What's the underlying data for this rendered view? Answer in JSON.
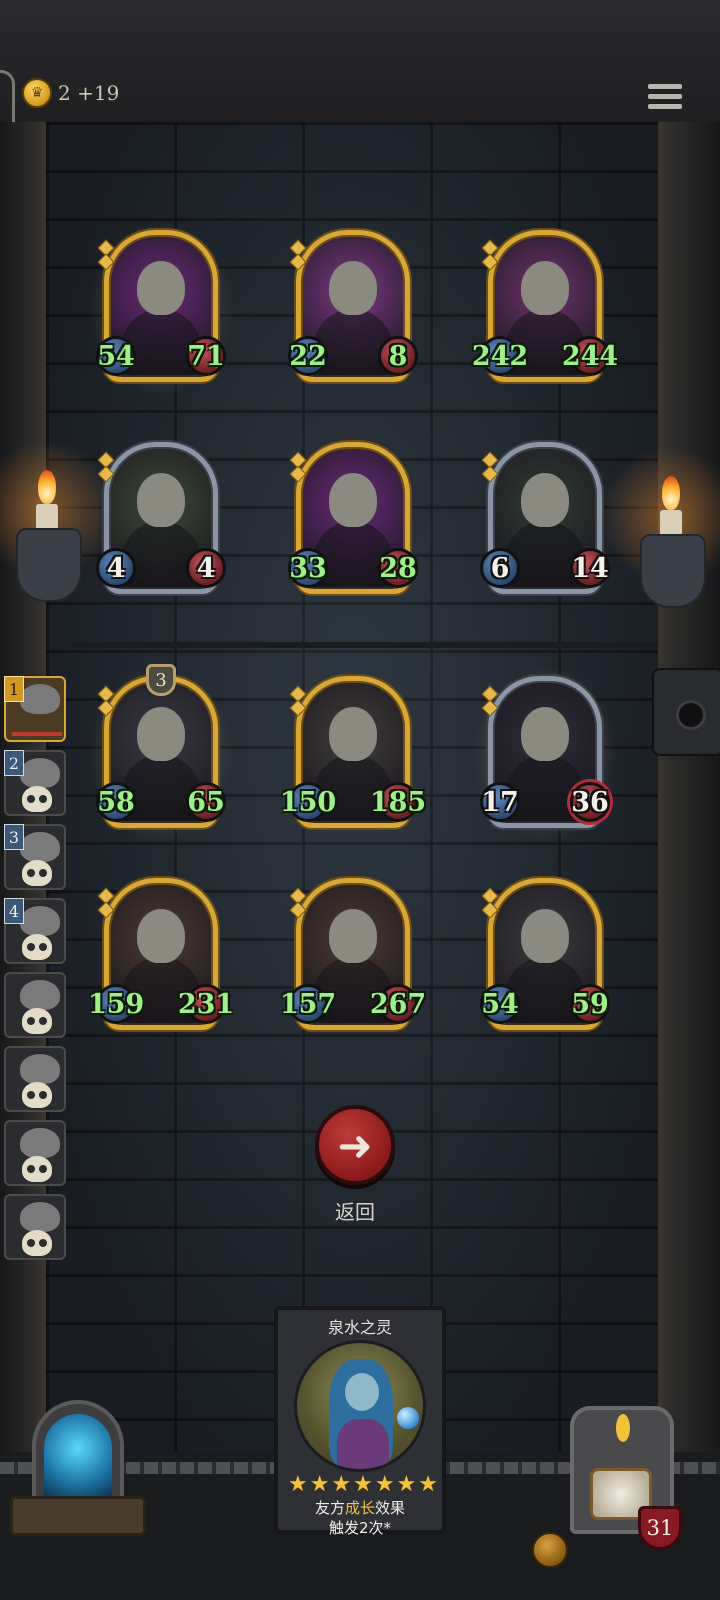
{
  "header": {
    "gold_label": "2 +19"
  },
  "colors": {
    "gold_frame": "#d7a73a",
    "silver_frame": "#8c95a6",
    "stat_green": "#9ef08a",
    "back_button": "#a42626"
  },
  "board": {
    "rows": [
      {
        "units": [
          {
            "name": "witch",
            "attack": "54",
            "health": "71",
            "frame": "gold",
            "buffed": true,
            "portrait": "#6b2a7a"
          },
          {
            "name": "rat",
            "attack": "22",
            "health": "8",
            "frame": "gold",
            "buffed": false,
            "portrait": "#7c3a86"
          },
          {
            "name": "bandit-bear",
            "attack": "242",
            "health": "244",
            "frame": "gold",
            "buffed": false,
            "portrait": "#6e3470"
          }
        ]
      },
      {
        "units": [
          {
            "name": "brawler",
            "attack": "4",
            "health": "4",
            "frame": "silver",
            "buffed": false,
            "portrait": "#3d4a35"
          },
          {
            "name": "vulture",
            "attack": "33",
            "health": "28",
            "frame": "gold",
            "buffed": false,
            "portrait": "#6a2a7a"
          },
          {
            "name": "golem",
            "attack": "6",
            "health": "14",
            "frame": "silver",
            "buffed": false,
            "portrait": "#2f3b33"
          }
        ]
      },
      {
        "units": [
          {
            "name": "armored-warrior",
            "attack": "58",
            "health": "65",
            "frame": "gold",
            "buffed": true,
            "level": "3",
            "portrait": "#3a3a44"
          },
          {
            "name": "knight",
            "attack": "150",
            "health": "185",
            "frame": "gold",
            "buffed": false,
            "portrait": "#3f3d3a"
          },
          {
            "name": "shadow-beast",
            "attack": "17",
            "health": "36",
            "frame": "silver",
            "buffed": true,
            "portrait": "#2b2e3a"
          }
        ]
      },
      {
        "units": [
          {
            "name": "ogre-1",
            "attack": "159",
            "health": "231",
            "frame": "gold",
            "buffed": false,
            "portrait": "#4b3a30"
          },
          {
            "name": "ogre-2",
            "attack": "157",
            "health": "267",
            "frame": "gold",
            "buffed": false,
            "portrait": "#4b3a30"
          },
          {
            "name": "rose-sage",
            "attack": "54",
            "health": "59",
            "frame": "gold",
            "buffed": false,
            "portrait": "#3a3a3d"
          }
        ]
      }
    ]
  },
  "queue": [
    {
      "num": "1",
      "active": true
    },
    {
      "num": "2",
      "active": false
    },
    {
      "num": "3",
      "active": false
    },
    {
      "num": "4",
      "active": false
    },
    {
      "num": "",
      "active": false
    },
    {
      "num": "",
      "active": false
    },
    {
      "num": "",
      "active": false
    },
    {
      "num": "",
      "active": false
    }
  ],
  "back_button": {
    "label": "返回"
  },
  "tooltip": {
    "title": "泉水之灵",
    "stars": 7,
    "desc_prefix": "友方",
    "desc_highlight": "成长",
    "desc_suffix": "效果",
    "desc_line2": "触发2次*"
  },
  "player": {
    "hp": "31"
  }
}
